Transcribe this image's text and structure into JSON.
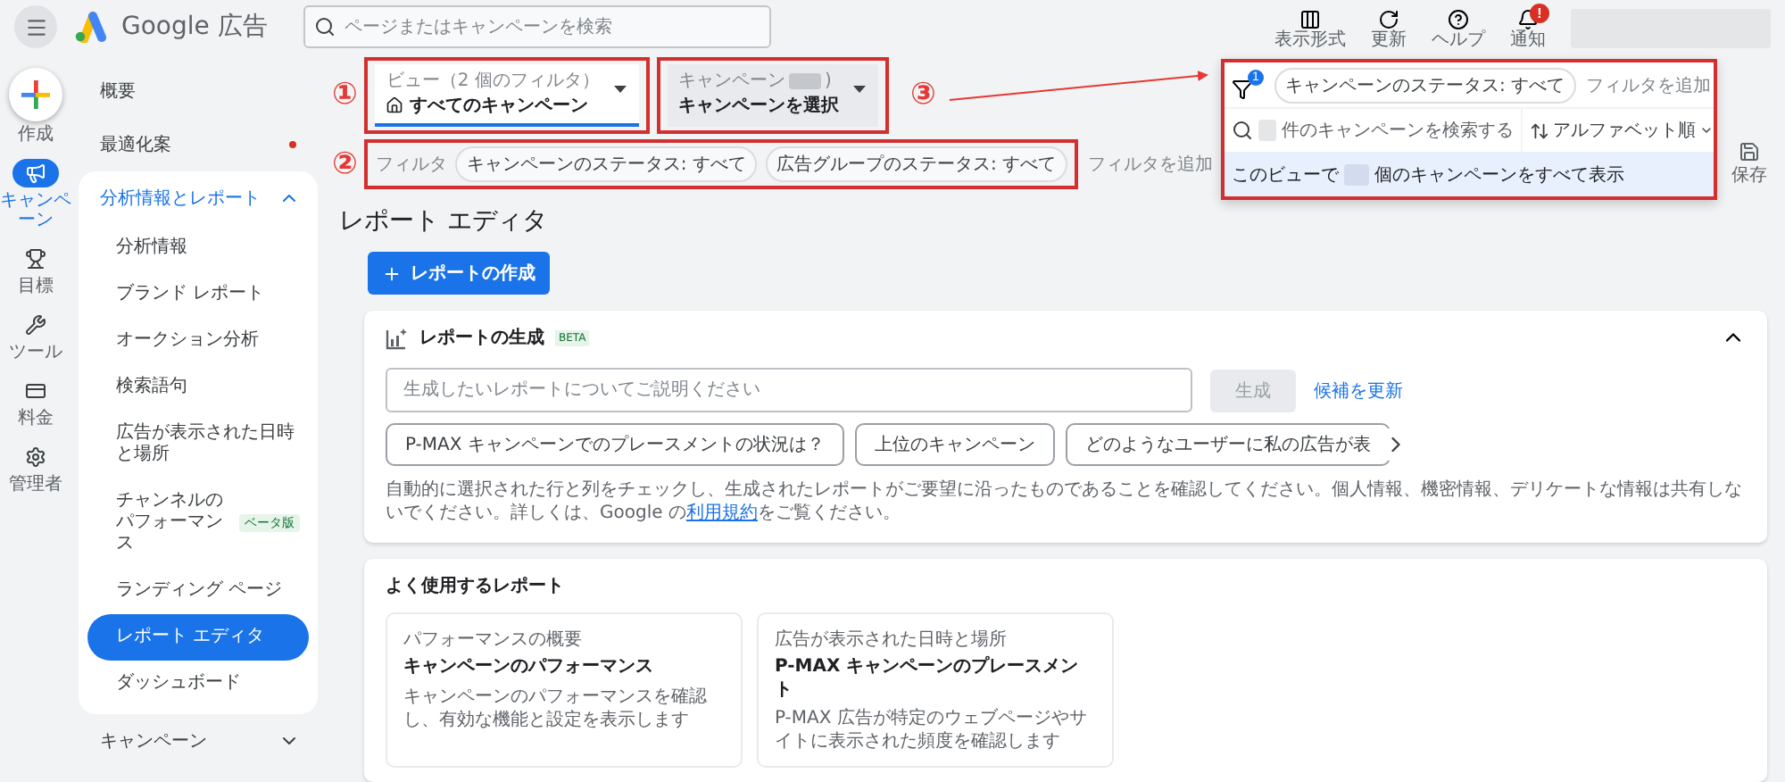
{
  "top_bar": {
    "product": "Google 広告",
    "search": {
      "placeholder": "ページまたはキャンペーンを検索"
    },
    "actions": [
      {
        "kind": "layout",
        "label": "表示形式"
      },
      {
        "kind": "refresh",
        "label": "更新"
      },
      {
        "kind": "help",
        "label": "ヘルプ"
      },
      {
        "kind": "bell",
        "label": "通知",
        "badge": "!"
      }
    ]
  },
  "rail": [
    {
      "kind": "create",
      "label": "作成",
      "selected": false
    },
    {
      "kind": "campaign",
      "label": "キャンペーン",
      "selected": true
    },
    {
      "kind": "goal",
      "label": "目標",
      "selected": false
    },
    {
      "kind": "tools",
      "label": "ツール",
      "selected": false
    },
    {
      "kind": "billing",
      "label": "料金",
      "selected": false
    },
    {
      "kind": "admin",
      "label": "管理者",
      "selected": false
    }
  ],
  "nav": [
    {
      "kind": "link",
      "label": "概要",
      "alert": false
    },
    {
      "kind": "link",
      "label": "最適化案",
      "alert": true
    },
    {
      "kind": "group",
      "label": "分析情報とレポート",
      "expanded": true,
      "children": [
        {
          "label": "分析情報",
          "selected": false
        },
        {
          "label": "ブランド レポート",
          "selected": false
        },
        {
          "label": "オークション分析",
          "selected": false
        },
        {
          "label": "検索語句",
          "selected": false
        },
        {
          "label": "広告が表示された日時と場所",
          "selected": false
        },
        {
          "label": "チャンネルのパフォーマンス",
          "badge": "ベータ版",
          "selected": false
        },
        {
          "label": "ランディング ページ",
          "selected": false
        },
        {
          "label": "レポート エディタ",
          "selected": true
        },
        {
          "label": "ダッシュボード",
          "selected": false
        }
      ]
    },
    {
      "kind": "group",
      "label": "キャンペーン",
      "expanded": false
    }
  ],
  "annotations": [
    "①",
    "②",
    "③"
  ],
  "toolbar": {
    "view": {
      "label": "ビュー（2 個のフィルタ）",
      "value": "すべてのキャンペーン"
    },
    "campaign": {
      "label": "キャンペーン",
      "label_end": ")",
      "value": "キャンペーンを選択"
    },
    "filters": {
      "label": "フィルタ",
      "chips": [
        "キャンペーンのステータス: すべて",
        "広告グループのステータス: すべて"
      ],
      "add": "フィルタを追加"
    },
    "save": "保存"
  },
  "dropdown": {
    "filter_count": "1",
    "chip": "キャンペーンのステータス: すべて",
    "add": "フィルタを追加",
    "search_placeholder": "件のキャンペーンを検索する",
    "sort": "アルファベット順",
    "show_all_prefix": "このビューで",
    "show_all_suffix": "個のキャンペーンをすべて表示"
  },
  "page_title": "レポート エディタ",
  "create_button": "レポートの作成",
  "generate_card": {
    "title": "レポートの生成",
    "badge": "BETA",
    "expanded": true,
    "prompt_placeholder": "生成したいレポートについてご説明ください",
    "generate": {
      "label": "生成",
      "disabled": true
    },
    "refresh_link": "候補を更新",
    "suggestions": [
      "P-MAX キャンペーンでのプレースメントの状況は？",
      "上位のキャンペーン",
      "どのようなユーザーに私の広告が表"
    ],
    "note": {
      "before": "自動的に選択された行と列をチェックし、生成されたレポートがご要望に沿ったものであることを確認してください。個人情報、機密情報、デリケートな情報は共有しないでください。詳しくは、Google の",
      "link": "利用規約",
      "after": "をご覧ください。"
    }
  },
  "frequent": {
    "title": "よく使用するレポート",
    "reports": [
      {
        "category": "パフォーマンスの概要",
        "title": "キャンペーンのパフォーマンス",
        "description": "キャンペーンのパフォーマンスを確認し、有効な機能と設定を表示します"
      },
      {
        "category": "広告が表示された日時と場所",
        "title": "P-MAX キャンペーンのプレースメント",
        "description": "P-MAX 広告が特定のウェブページやサイトに表示された頻度を確認します"
      }
    ]
  }
}
